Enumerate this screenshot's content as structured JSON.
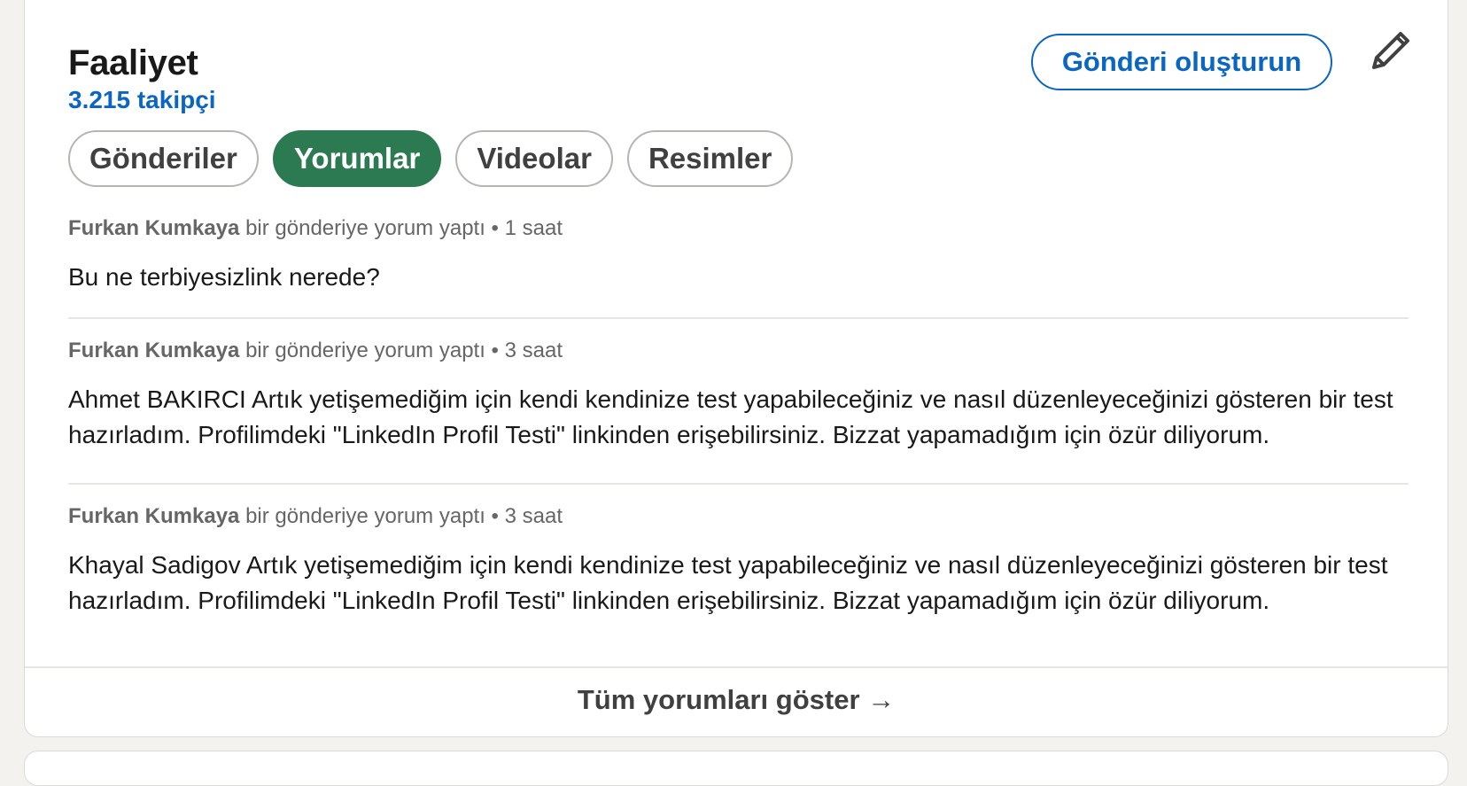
{
  "activity": {
    "title": "Faaliyet",
    "followers": "3.215 takipçi",
    "create_post_label": "Gönderi oluşturun",
    "edit_icon": "pencil-icon",
    "accent_color": "#0a66c2",
    "active_pill_color": "#2c7a52"
  },
  "tabs": [
    {
      "label": "Gönderiler",
      "active": false
    },
    {
      "label": "Yorumlar",
      "active": true
    },
    {
      "label": "Videolar",
      "active": false
    },
    {
      "label": "Resimler",
      "active": false
    }
  ],
  "comments": [
    {
      "author": "Furkan Kumkaya",
      "action": " bir gönderiye yorum yaptı",
      "time": "1 saat",
      "text": "Bu ne terbiyesizlink nerede?"
    },
    {
      "author": "Furkan Kumkaya",
      "action": " bir gönderiye yorum yaptı",
      "time": "3 saat",
      "text": "Ahmet BAKIRCI Artık yetişemediğim için kendi kendinize test yapabileceğiniz ve nasıl düzenleyeceğinizi gösteren bir test hazırladım. Profilimdeki \"LinkedIn Profil Testi\" linkinden erişebilirsiniz. Bizzat yapamadığım için özür diliyorum."
    },
    {
      "author": "Furkan Kumkaya",
      "action": " bir gönderiye yorum yaptı",
      "time": "3 saat",
      "text": "Khayal Sadigov Artık yetişemediğim için kendi kendinize test yapabileceğiniz ve nasıl düzenleyeceğinizi gösteren bir test hazırladım. Profilimdeki \"LinkedIn Profil Testi\" linkinden erişebilirsiniz. Bizzat yapamadığım için özür diliyorum."
    }
  ],
  "separator": " • ",
  "show_all": "Tüm yorumları göster →"
}
